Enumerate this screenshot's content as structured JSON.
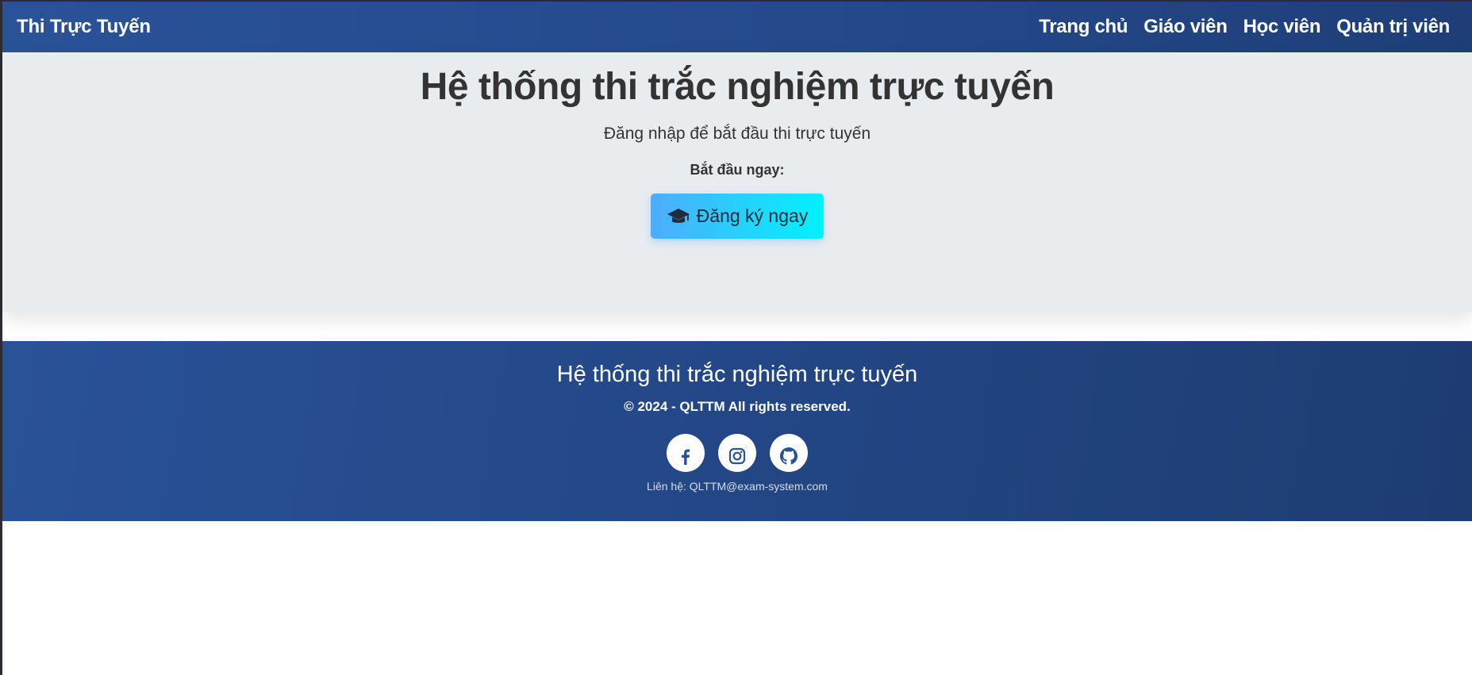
{
  "navbar": {
    "brand": "Thi Trực Tuyến",
    "links": [
      "Trang chủ",
      "Giáo viên",
      "Học viên",
      "Quản trị viên"
    ]
  },
  "hero": {
    "title": "Hệ thống thi trắc nghiệm trực tuyến",
    "subtitle": "Đăng nhập để bắt đầu thi trực tuyến",
    "cta_label": "Bắt đầu ngay:",
    "cta_button": "Đăng ký ngay",
    "cta_icon": "graduation-cap-icon"
  },
  "footer": {
    "title": "Hệ thống thi trắc nghiệm trực tuyến",
    "copyright": "© 2024 - QLTTM All rights reserved.",
    "social": [
      "facebook-icon",
      "instagram-icon",
      "github-icon"
    ],
    "contact": "Liên hệ: QLTTM@exam-system.com"
  },
  "colors": {
    "primary": "#2a5298",
    "primary_dark": "#1e3c72",
    "hero_bg": "#e9ecef",
    "cta_start": "#4facfe",
    "cta_end": "#00f2fe"
  }
}
